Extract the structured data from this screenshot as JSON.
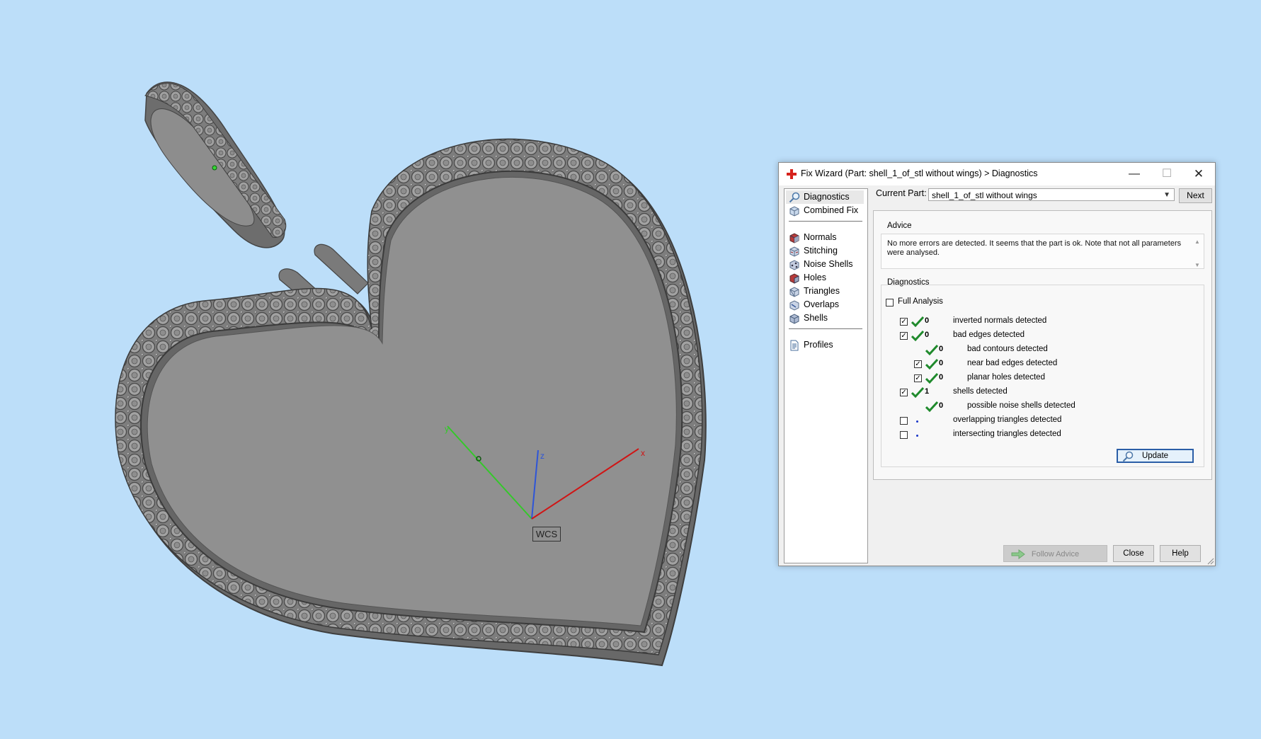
{
  "viewport": {
    "axis_labels": {
      "x": "x",
      "y": "y",
      "z": "z"
    },
    "wcs_label": "WCS",
    "colors": {
      "background": "#bcdef9",
      "model": "#8c8c8c",
      "x_axis": "#d01515",
      "y_axis": "#34c82a",
      "z_axis": "#2e55d8"
    }
  },
  "dialog": {
    "title": "Fix Wizard (Part: shell_1_of_stl without wings) > Diagnostics",
    "title_icon": "red-cross-icon",
    "window_buttons": {
      "minimize": "—",
      "maximize": "☐",
      "close": "✕"
    },
    "nav": {
      "items": [
        {
          "label": "Diagnostics",
          "icon": "magnifier-icon",
          "selected": true
        },
        {
          "label": "Combined Fix",
          "icon": "cube-icon"
        },
        {
          "label": "Normals",
          "icon": "normals-cube-icon"
        },
        {
          "label": "Stitching",
          "icon": "stitching-cube-icon"
        },
        {
          "label": "Noise Shells",
          "icon": "noise-shells-icon"
        },
        {
          "label": "Holes",
          "icon": "holes-cube-icon"
        },
        {
          "label": "Triangles",
          "icon": "triangles-cube-icon"
        },
        {
          "label": "Overlaps",
          "icon": "overlaps-cube-icon"
        },
        {
          "label": "Shells",
          "icon": "shells-cube-icon"
        },
        {
          "label": "Profiles",
          "icon": "profiles-document-icon"
        }
      ]
    },
    "current_part": {
      "label": "Current Part:",
      "value": "shell_1_of_stl without wings",
      "next_label": "Next"
    },
    "advice": {
      "legend": "Advice",
      "text": "No more errors are detected. It seems that the part is ok. Note that not all parameters were analysed."
    },
    "diagnostics": {
      "legend": "Diagnostics",
      "full_analysis_label": "Full Analysis",
      "full_analysis_checked": false,
      "rows": [
        {
          "checkbox": true,
          "checked": true,
          "status": "ok",
          "count": "0",
          "label": "inverted normals detected",
          "indent": 0
        },
        {
          "checkbox": true,
          "checked": true,
          "status": "ok",
          "count": "0",
          "label": "bad edges detected",
          "indent": 0
        },
        {
          "checkbox": false,
          "checked": false,
          "status": "ok",
          "count": "0",
          "label": "bad contours detected",
          "indent": 1
        },
        {
          "checkbox": true,
          "checked": true,
          "status": "ok",
          "count": "0",
          "label": "near bad edges detected",
          "indent": 1
        },
        {
          "checkbox": true,
          "checked": true,
          "status": "ok",
          "count": "0",
          "label": "planar holes detected",
          "indent": 1
        },
        {
          "checkbox": true,
          "checked": true,
          "status": "ok",
          "count": "1",
          "label": "shells detected",
          "indent": 0
        },
        {
          "checkbox": false,
          "checked": false,
          "status": "ok",
          "count": "0",
          "label": "possible noise shells detected",
          "indent": 1
        },
        {
          "checkbox": true,
          "checked": false,
          "status": "not-analysed",
          "count": "",
          "label": "overlapping triangles detected",
          "indent": 0
        },
        {
          "checkbox": true,
          "checked": false,
          "status": "not-analysed",
          "count": "",
          "label": "intersecting triangles detected",
          "indent": 0
        }
      ],
      "update_label": "Update"
    },
    "buttons": {
      "follow_advice": "Follow Advice",
      "close": "Close",
      "help": "Help"
    }
  }
}
